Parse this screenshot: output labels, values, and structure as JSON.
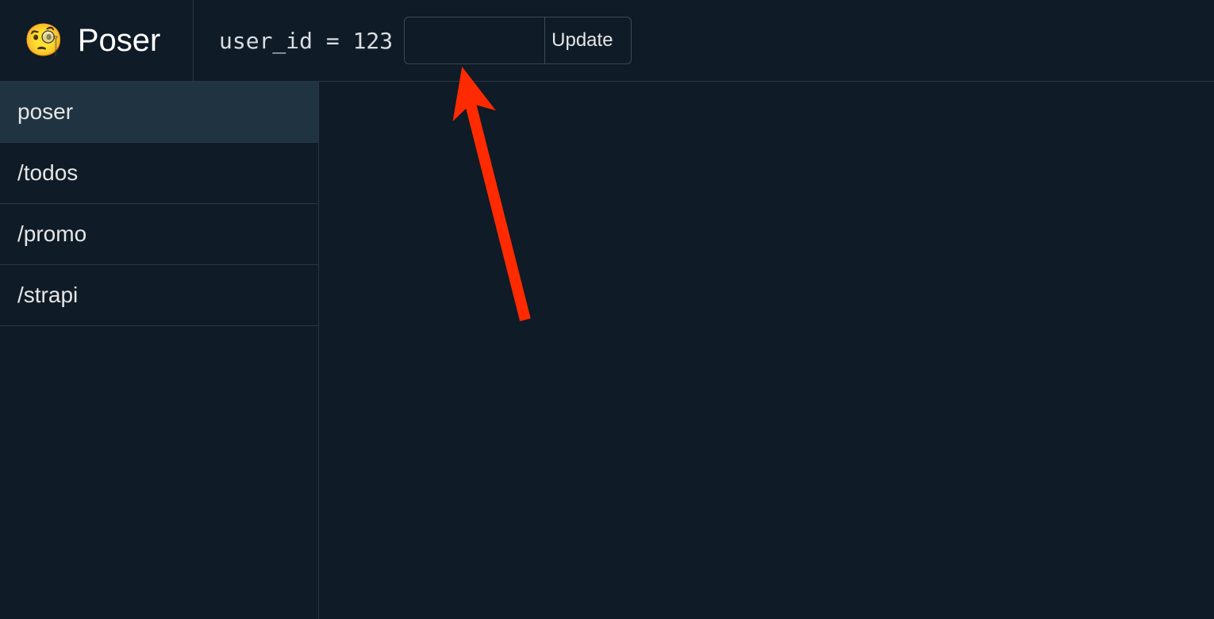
{
  "brand": {
    "emoji": "🧐",
    "title": "Poser"
  },
  "header": {
    "user_id_label": "user_id = 123",
    "user_id_value": "",
    "update_label": "Update"
  },
  "sidebar": {
    "items": [
      {
        "label": "poser",
        "active": true
      },
      {
        "label": "/todos",
        "active": false
      },
      {
        "label": "/promo",
        "active": false
      },
      {
        "label": "/strapi",
        "active": false
      }
    ]
  },
  "annotation": {
    "arrow_color": "#ff2a00"
  }
}
